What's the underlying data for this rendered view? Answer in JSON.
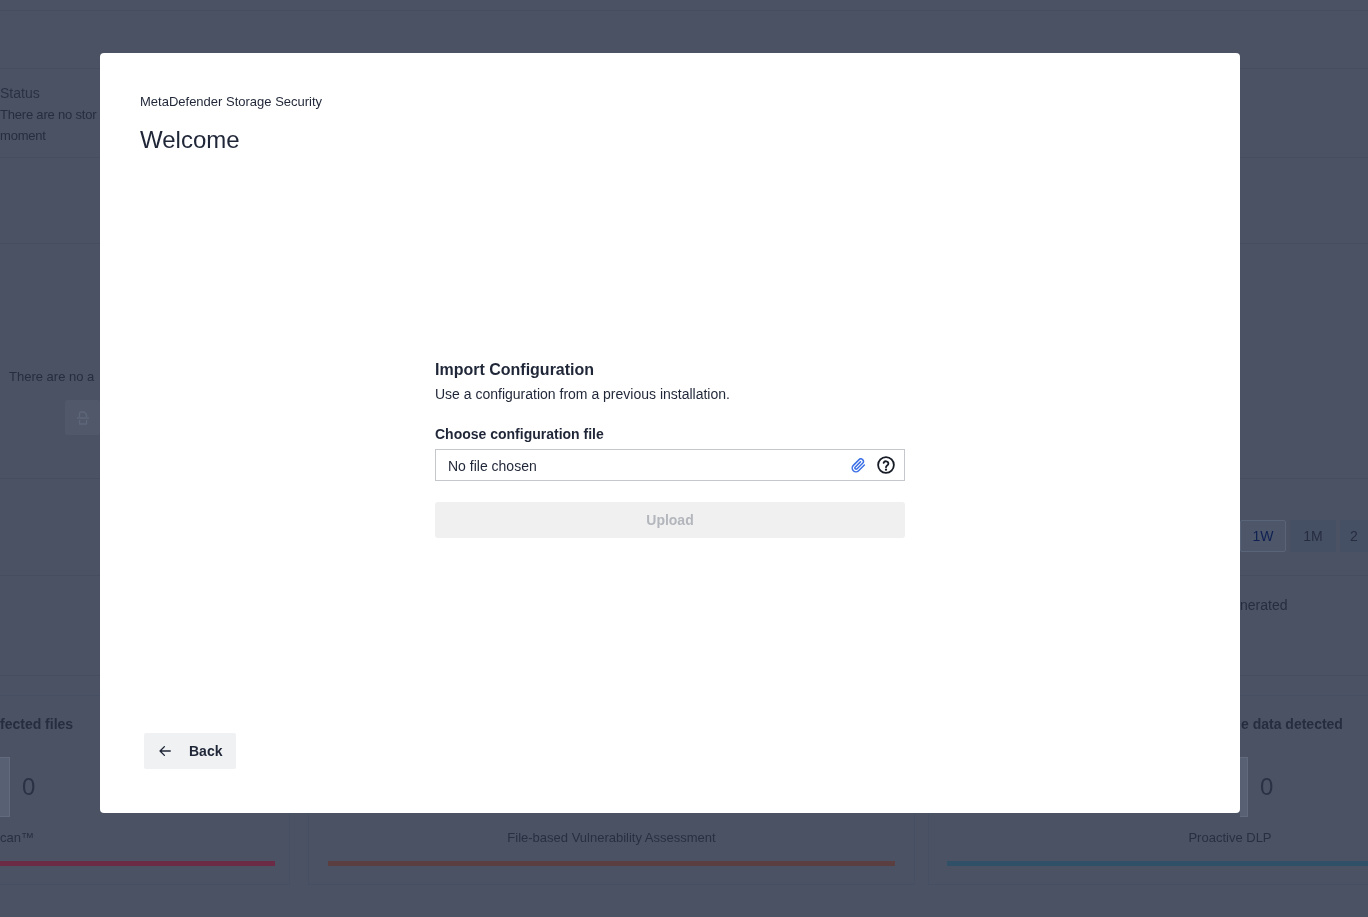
{
  "dashboard": {
    "status_panel": {
      "heading": "Status",
      "message_lines": [
        "There are no stor",
        "moment"
      ]
    },
    "activity_panel": {
      "message": "There are no a"
    },
    "range_buttons": [
      {
        "label": "1W",
        "selected": true
      },
      {
        "label": "1M",
        "selected": false
      },
      {
        "label": "2",
        "selected": false
      }
    ],
    "report_panel": {
      "message": "nerated"
    },
    "metric_cards": [
      {
        "title": "fected files",
        "value": "0",
        "label": "can™",
        "color": "#6c2b44"
      },
      {
        "label": "File-based Vulnerability Assessment",
        "color": "#5b3f40"
      },
      {
        "title": "e data detected",
        "value": "0",
        "label": "Proactive DLP",
        "color": "#2f5066"
      }
    ]
  },
  "dialog": {
    "product": "MetaDefender Storage Security",
    "title": "Welcome",
    "section_title": "Import Configuration",
    "section_description": "Use a configuration from a previous installation.",
    "file_field": {
      "label": "Choose configuration file",
      "value": "No file chosen"
    },
    "upload_button": {
      "label": "Upload",
      "disabled": true
    },
    "back_button": {
      "label": "Back"
    }
  }
}
